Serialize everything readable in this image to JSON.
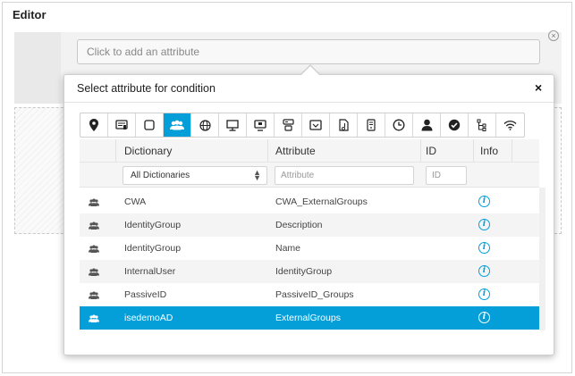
{
  "editor": {
    "title": "Editor"
  },
  "condition": {
    "attribute_placeholder": "Click to add an attribute"
  },
  "popup": {
    "title": "Select attribute for condition",
    "close_symbol": "×",
    "icon_bar": [
      {
        "name": "location-pin-icon",
        "active": false
      },
      {
        "name": "card-reader-icon",
        "active": false
      },
      {
        "name": "square-icon",
        "active": false
      },
      {
        "name": "user-group-icon",
        "active": true
      },
      {
        "name": "globe-icon",
        "active": false
      },
      {
        "name": "monitor-icon",
        "active": false
      },
      {
        "name": "desktop-icon",
        "active": false
      },
      {
        "name": "network-device-icon",
        "active": false
      },
      {
        "name": "window-icon",
        "active": false
      },
      {
        "name": "document-icon",
        "active": false
      },
      {
        "name": "server-icon",
        "active": false
      },
      {
        "name": "clock-icon",
        "active": false
      },
      {
        "name": "user-icon",
        "active": false
      },
      {
        "name": "checkmark-circle-icon",
        "active": false
      },
      {
        "name": "hierarchy-icon",
        "active": false
      },
      {
        "name": "wifi-icon",
        "active": false
      }
    ],
    "table": {
      "headers": {
        "dictionary": "Dictionary",
        "attribute": "Attribute",
        "id": "ID",
        "info": "Info"
      },
      "filters": {
        "dictionary_value": "All Dictionaries",
        "attribute_placeholder": "Attribute",
        "id_placeholder": "ID"
      },
      "rows": [
        {
          "dictionary": "CWA",
          "attribute": "CWA_ExternalGroups",
          "id": "",
          "selected": false
        },
        {
          "dictionary": "IdentityGroup",
          "attribute": "Description",
          "id": "",
          "selected": false
        },
        {
          "dictionary": "IdentityGroup",
          "attribute": "Name",
          "id": "",
          "selected": false
        },
        {
          "dictionary": "InternalUser",
          "attribute": "IdentityGroup",
          "id": "",
          "selected": false
        },
        {
          "dictionary": "PassiveID",
          "attribute": "PassiveID_Groups",
          "id": "",
          "selected": false
        },
        {
          "dictionary": "isedemoAD",
          "attribute": "ExternalGroups",
          "id": "",
          "selected": true
        }
      ],
      "info_symbol": "i"
    }
  },
  "colors": {
    "accent": "#049fd9",
    "border": "#cfcfcf",
    "row_alt": "#f4f4f4"
  }
}
